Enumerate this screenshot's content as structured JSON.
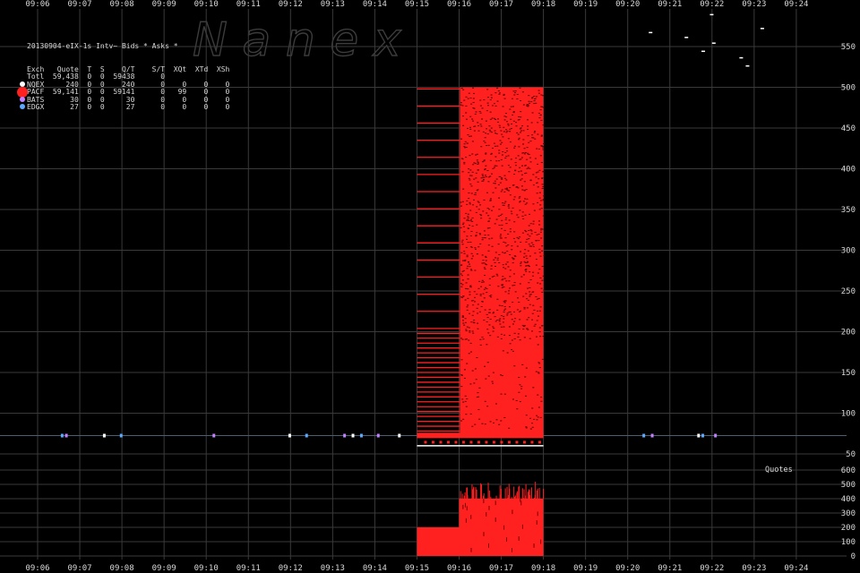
{
  "chart_data": {
    "type": "scatter",
    "title": "20130904-eIX-1s Intv~ Bids * Asks *",
    "watermark": "N a n e x",
    "x_ticks": [
      "09:06",
      "09:07",
      "09:08",
      "09:09",
      "09:10",
      "09:11",
      "09:12",
      "09:13",
      "09:14",
      "09:15",
      "09:16",
      "09:17",
      "09:18",
      "09:19",
      "09:20",
      "09:21",
      "09:22",
      "09:23",
      "09:24"
    ],
    "price_axis": {
      "ticks": [
        50,
        100,
        150,
        200,
        250,
        300,
        350,
        400,
        450,
        500,
        550
      ],
      "ylim": [
        50,
        590
      ]
    },
    "quote_axis": {
      "label": "Quotes",
      "ticks": [
        0,
        100,
        200,
        300,
        400,
        500,
        600
      ],
      "ylim": [
        0,
        600
      ]
    },
    "table": {
      "header": [
        "Exch",
        "Quote",
        "T",
        "S",
        "Q/T",
        "S/T",
        "XQt",
        "XTd",
        "XSh"
      ],
      "rows": [
        {
          "exch": "Totl",
          "quote": "59,438",
          "t": "0",
          "s": "0",
          "qt": "59438",
          "st": "0",
          "xqt": "",
          "xtd": "",
          "xsh": ""
        },
        {
          "exch": "NQEX",
          "quote": "240",
          "t": "0",
          "s": "0",
          "qt": "240",
          "st": "0",
          "xqt": "0",
          "xtd": "0",
          "xsh": "0"
        },
        {
          "exch": "PACF",
          "quote": "59,141",
          "t": "0",
          "s": "0",
          "qt": "59141",
          "st": "0",
          "xqt": "99",
          "xtd": "0",
          "xsh": "0"
        },
        {
          "exch": "BATS",
          "quote": "30",
          "t": "0",
          "s": "0",
          "qt": "30",
          "st": "0",
          "xqt": "0",
          "xtd": "0",
          "xsh": "0"
        },
        {
          "exch": "EDGX",
          "quote": "27",
          "t": "0",
          "s": "0",
          "qt": "27",
          "st": "0",
          "xqt": "0",
          "xtd": "0",
          "xsh": "0"
        }
      ]
    },
    "series": [
      {
        "name": "NQEX",
        "color": "#ffffff"
      },
      {
        "name": "PACF",
        "color": "#ff2020"
      },
      {
        "name": "BATS",
        "color": "#c080ff"
      },
      {
        "name": "EDGX",
        "color": "#5fa8ff"
      }
    ],
    "baseline_price": 72.5,
    "activity_window": {
      "start": "09:15:00",
      "end": "09:18:00",
      "dense_start": "09:16:01"
    },
    "quote_rate_segments": [
      {
        "from": "09:15:00",
        "to": "09:16:00",
        "value": 200
      },
      {
        "from": "09:16:00",
        "to": "09:18:00",
        "value": 400
      }
    ],
    "colors": {
      "background": "#000000",
      "grid": "#3a3a3a",
      "accent": "#ff2020",
      "text": "#d8d8d8"
    }
  }
}
